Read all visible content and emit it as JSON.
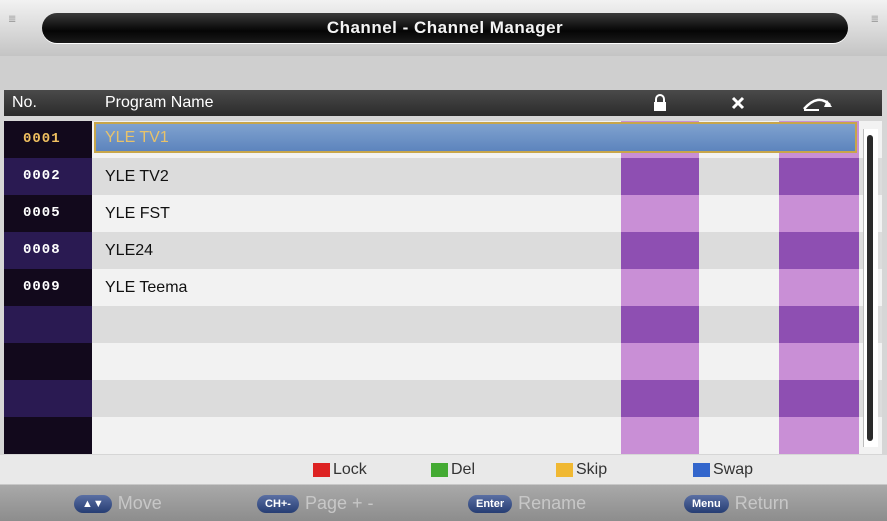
{
  "title": "Channel - Channel Manager",
  "header": {
    "no_label": "No.",
    "name_label": "Program Name",
    "lock_icon": "lock-icon",
    "delete_icon": "close-icon",
    "swap_icon": "swap-arrow-icon"
  },
  "rows": [
    {
      "no": "0001",
      "name": "YLE TV1",
      "selected": true
    },
    {
      "no": "0002",
      "name": "YLE TV2"
    },
    {
      "no": "0005",
      "name": "YLE FST"
    },
    {
      "no": "0008",
      "name": "YLE24"
    },
    {
      "no": "0009",
      "name": "YLE Teema"
    },
    {
      "no": "",
      "name": ""
    },
    {
      "no": "",
      "name": ""
    },
    {
      "no": "",
      "name": ""
    },
    {
      "no": "",
      "name": ""
    }
  ],
  "legend": [
    {
      "label": "Lock",
      "color": "#dd2222"
    },
    {
      "label": "Del",
      "color": "#44aa33"
    },
    {
      "label": "Skip",
      "color": "#f0b832"
    },
    {
      "label": "Swap",
      "color": "#3366cc"
    }
  ],
  "help": [
    {
      "key": "▲▼",
      "action": "Move"
    },
    {
      "key": "CH+-",
      "action": "Page + -"
    },
    {
      "key": "Enter",
      "action": "Rename"
    },
    {
      "key": "Menu",
      "action": "Return"
    }
  ],
  "colors": {
    "purple_dark": "#8e4fb2",
    "purple_light": "#c98fd6",
    "num_dark": "#12091c",
    "num_mid": "#2a1a52",
    "row_light": "#f2f2f2",
    "row_gray": "#dcdcdc"
  }
}
